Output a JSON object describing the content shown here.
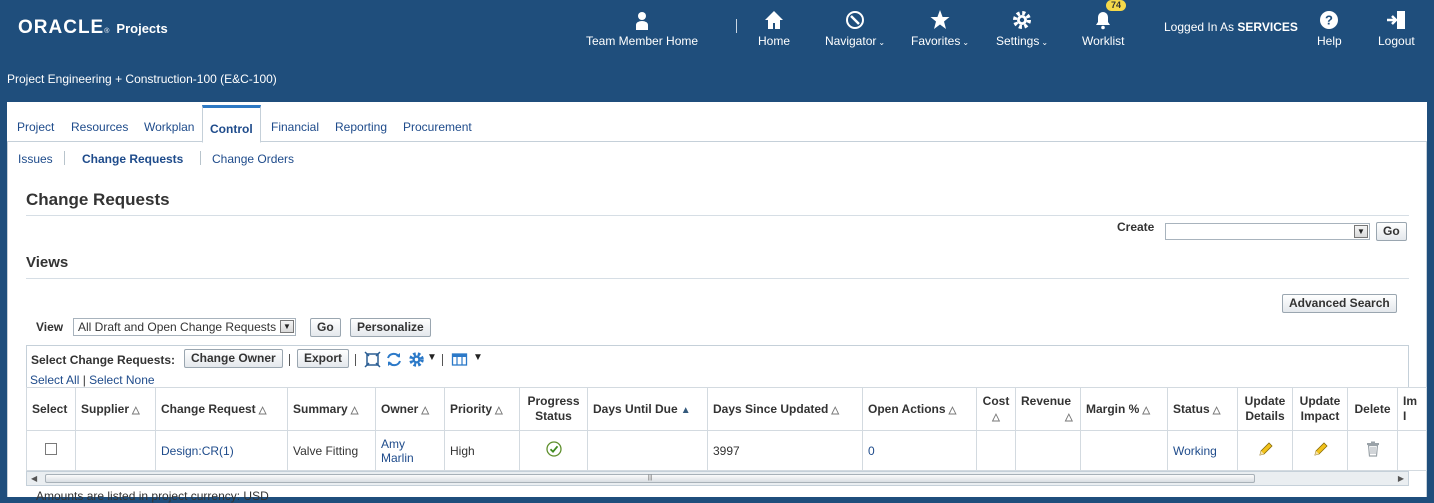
{
  "brand": {
    "logo": "ORACLE",
    "app": "Projects"
  },
  "header": {
    "team_home": "Team Member Home",
    "home": "Home",
    "navigator": "Navigator",
    "favorites": "Favorites",
    "settings": "Settings",
    "worklist": "Worklist",
    "worklist_count": "74",
    "logged_in_prefix": "Logged In As",
    "logged_in_user": "SERVICES",
    "help": "Help",
    "logout": "Logout"
  },
  "project_name": "Project Engineering + Construction-100 (E&C-100)",
  "tabs": [
    "Project",
    "Resources",
    "Workplan",
    "Control",
    "Financial",
    "Reporting",
    "Procurement"
  ],
  "subtabs": [
    "Issues",
    "Change Requests",
    "Change Orders"
  ],
  "page": {
    "title": "Change Requests",
    "create_label": "Create",
    "go": "Go",
    "views_title": "Views",
    "advanced_search": "Advanced Search",
    "view_label": "View",
    "view_value": "All Draft and Open Change Requests",
    "personalize": "Personalize"
  },
  "toolbar": {
    "select_label": "Select Change Requests:",
    "change_owner": "Change Owner",
    "export": "Export",
    "select_all": "Select All",
    "select_none": "Select None"
  },
  "table": {
    "headers": {
      "select": "Select",
      "supplier": "Supplier",
      "change_request": "Change Request",
      "summary": "Summary",
      "owner": "Owner",
      "priority": "Priority",
      "progress_status": "Progress Status",
      "days_until_due": "Days Until Due",
      "days_since_updated": "Days Since Updated",
      "open_actions": "Open Actions",
      "cost": "Cost",
      "revenue": "Revenue",
      "margin": "Margin %",
      "status": "Status",
      "update_details": "Update Details",
      "update_impact": "Update Impact",
      "delete": "Delete",
      "impl": "Im I"
    },
    "rows": [
      {
        "supplier": "",
        "change_request": "Design:CR(1)",
        "summary": "Valve Fitting",
        "owner": "Amy Marlin",
        "priority": "High",
        "days_until_due": "",
        "days_since_updated": "3997",
        "open_actions": "0",
        "cost": "",
        "revenue": "",
        "margin": "",
        "status": "Working"
      }
    ]
  },
  "footnote": "Amounts are listed in project currency: USD",
  "colors": {
    "header_bg": "#1f4e7c",
    "link": "#1e4b8b",
    "active_tab_border": "#2d79c4",
    "badge": "#f5d94a"
  }
}
